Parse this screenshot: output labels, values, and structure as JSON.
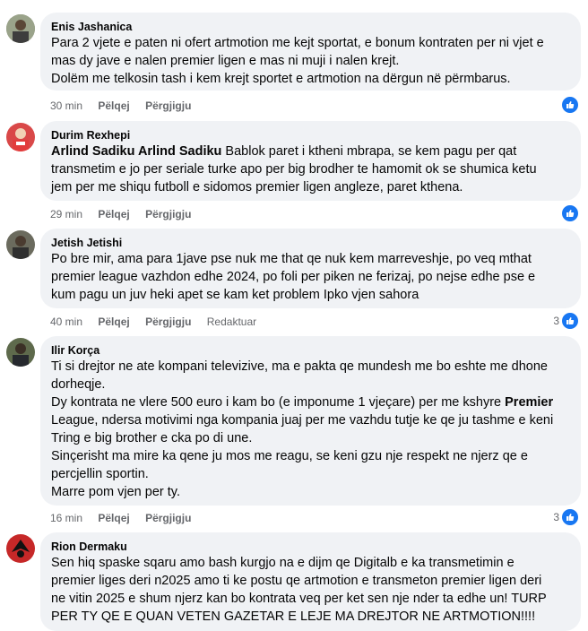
{
  "comments": [
    {
      "author": "Enis Jashanica",
      "lines": [
        "Para 2 vjete e paten ni ofert artmotion me kejt sportat, e bonum kontraten per ni vjet e",
        "mas dy jave e nalen premier ligen e mas ni muji i nalen krejt.",
        "Dolëm me telkosin tash i kem krejt sportet e artmotion na dërgun në përmbarus."
      ],
      "time": "30 min",
      "like": "Pëlqej",
      "reply": "Përgjigju"
    },
    {
      "author": "Durim Rexhepi",
      "mention": "Arlind Sadiku Arlind Sadiku",
      "lines": [
        " Bablok paret i ktheni mbrapa, se kem pagu per qat",
        "transmetim e jo per seriale turke apo per big brodher te hamomit ok se shumica ketu",
        "jem per me shiqu futboll e sidomos premier ligen angleze, paret kthena."
      ],
      "time": "29 min",
      "like": "Pëlqej",
      "reply": "Përgjigju"
    },
    {
      "author": "Jetish Jetishi",
      "lines": [
        "Po bre mir, ama para 1jave pse nuk me that qe nuk kem marreveshje, po veq mthat",
        "premier league vazhdon edhe 2024, po foli per piken ne ferizaj, po nejse edhe pse e",
        "kum pagu un juv heki apet se kam ket problem Ipko vjen sahora"
      ],
      "time": "40 min",
      "like": "Pëlqej",
      "reply": "Përgjigju",
      "edited": "Redaktuar",
      "reaction_count": "3"
    },
    {
      "author": "Ilir Korça",
      "lines": [
        "Ti si drejtor ne ate kompani televizive, ma e pakta qe mundesh me bo eshte me dhone",
        "dorheqje.",
        "Dy kontrata ne vlere 500 euro i kam bo (e imponume 1 vjeçare) per me kshyre ",
        "League, ndersa motivimi nga kompania juaj per me vazhdu tutje ke qe ju tashme e keni",
        "Tring e big brother e cka po di une.",
        "Sinçerisht ma mire ka qene ju mos me reagu, se keni gzu nje respekt ne njerz qe e",
        "percjellin sportin.",
        "Marre pom vjen per ty."
      ],
      "bold_a": "Premier",
      "time": "16 min",
      "like": "Pëlqej",
      "reply": "Përgjigju",
      "reaction_count": "3"
    },
    {
      "author": "Rion Dermaku",
      "lines": [
        "Sen hiq spaske sqaru amo bash kurgjo na e dijm qe Digitalb e ka transmetimin e",
        "premier liges deri n2025 amo ti ke postu qe artmotion e transmeton premier ligen deri",
        "ne vitin 2025 e shum njerz kan bo kontrata veq per ket sen nje nder ta edhe un! TURP",
        "PER TY QE E QUAN VETEN GAZETAR E LEJE MA DREJTOR NE ARTMOTION!!!!"
      ]
    }
  ],
  "colors": {
    "like_blue": "#1877f2",
    "bubble": "#f0f2f5",
    "meta": "#65676b"
  },
  "icons": {
    "like": "thumbs-up-icon"
  }
}
